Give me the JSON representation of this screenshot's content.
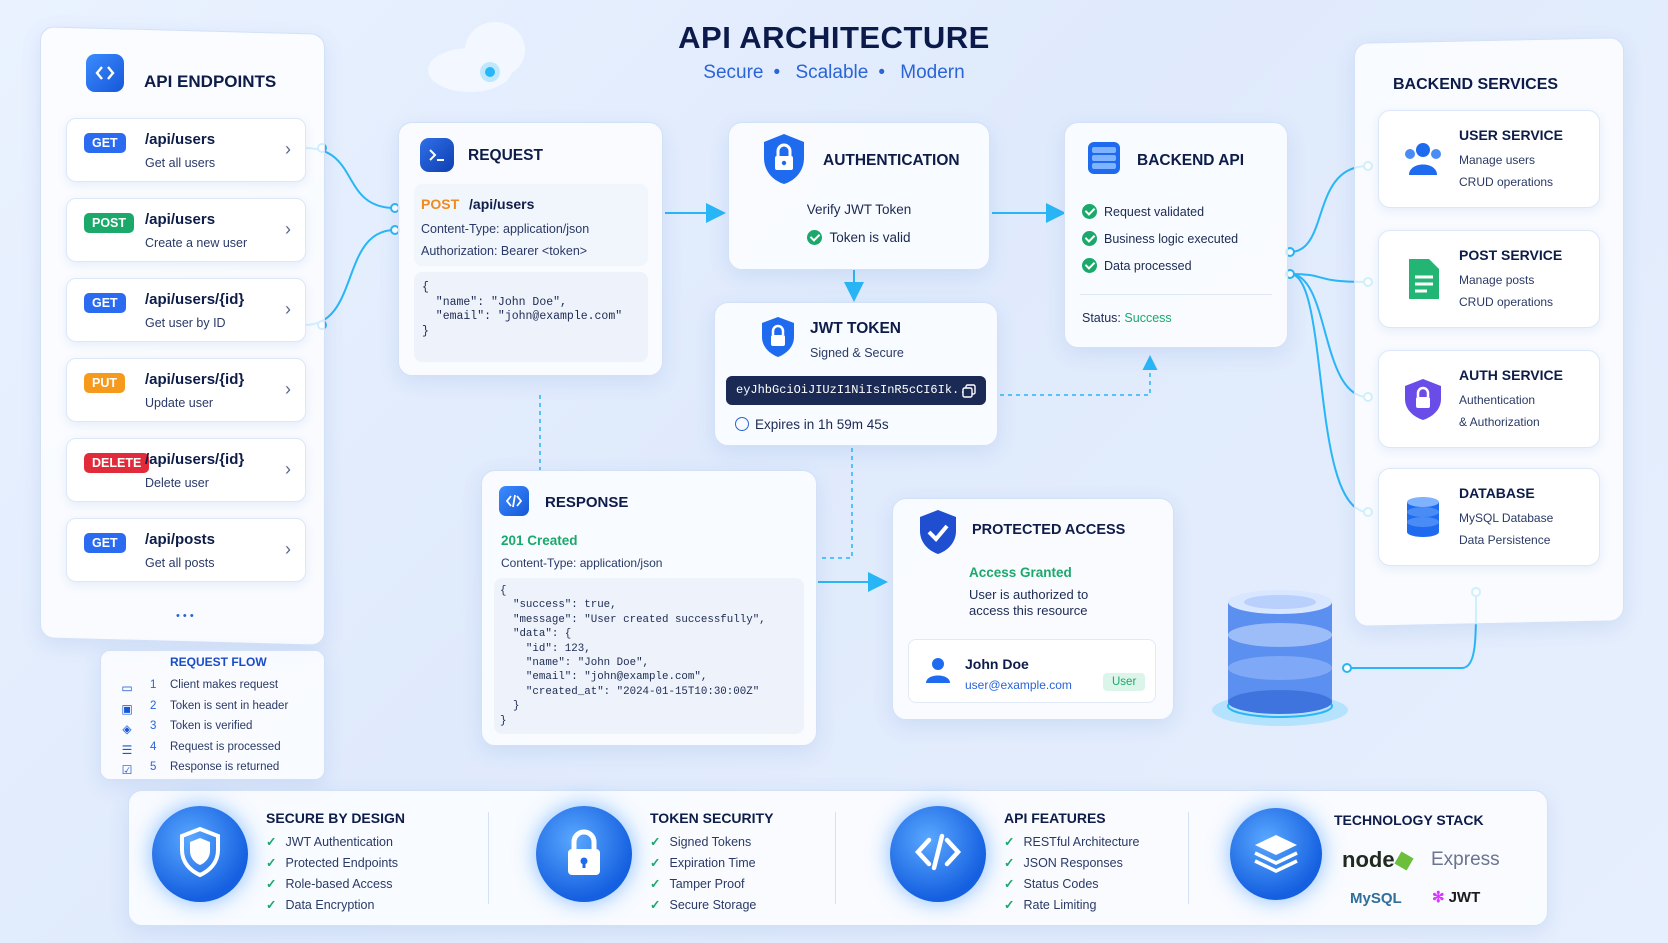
{
  "header": {
    "title": "API ARCHITECTURE",
    "tags": [
      "Secure",
      "Scalable",
      "Modern"
    ]
  },
  "endpoints": {
    "title": "API ENDPOINTS",
    "items": [
      {
        "method": "GET",
        "color": "#2a6bf2",
        "path": "/api/users",
        "desc": "Get all users"
      },
      {
        "method": "POST",
        "color": "#1aa96a",
        "path": "/api/users",
        "desc": "Create a new user"
      },
      {
        "method": "GET",
        "color": "#2a6bf2",
        "path": "/api/users/{id}",
        "desc": "Get user by ID"
      },
      {
        "method": "PUT",
        "color": "#f59a1c",
        "path": "/api/users/{id}",
        "desc": "Update user"
      },
      {
        "method": "DELETE",
        "color": "#e22b3a",
        "path": "/api/users/{id}",
        "desc": "Delete user"
      },
      {
        "method": "GET",
        "color": "#2a6bf2",
        "path": "/api/posts",
        "desc": "Get all posts"
      }
    ],
    "more": "• • •"
  },
  "request_flow": {
    "title": "REQUEST FLOW",
    "steps": [
      {
        "num": "1",
        "text": "Client makes request",
        "icon": "monitor-icon"
      },
      {
        "num": "2",
        "text": "Token is sent in header",
        "icon": "lock-icon"
      },
      {
        "num": "3",
        "text": "Token is verified",
        "icon": "shield-icon"
      },
      {
        "num": "4",
        "text": "Request is processed",
        "icon": "server-icon"
      },
      {
        "num": "5",
        "text": "Response is returned",
        "icon": "check-square-icon"
      }
    ]
  },
  "request": {
    "title": "REQUEST",
    "method": "POST",
    "path": "/api/users",
    "content_type_label": "Content-Type:",
    "content_type": "application/json",
    "auth_label": "Authorization:",
    "auth": "Bearer <token>",
    "body_lines": [
      "{",
      "  \"name\": \"John Doe\",",
      "  \"email\": \"john@example.com\"",
      "}"
    ]
  },
  "authentication": {
    "title": "AUTHENTICATION",
    "line1": "Verify JWT Token",
    "line2": "Token is valid"
  },
  "jwt": {
    "title": "JWT TOKEN",
    "subtitle": "Signed & Secure",
    "token": "eyJhbGciOiJIUzI1NiIsInR5cCI6Ik..",
    "expires": "Expires in 1h 59m 45s"
  },
  "backend_api": {
    "title": "BACKEND API",
    "checks": [
      "Request validated",
      "Business logic executed",
      "Data processed"
    ],
    "status_label": "Status:",
    "status": "Success"
  },
  "response": {
    "title": "RESPONSE",
    "code": "201 Created",
    "content_type_label": "Content-Type:",
    "content_type": "application/json",
    "body_lines": [
      "{",
      "  \"success\": true,",
      "  \"message\": \"User created successfully\",",
      "  \"data\": {",
      "    \"id\": 123,",
      "    \"name\": \"John Doe\",",
      "    \"email\": \"john@example.com\",",
      "    \"created_at\": \"2024-01-15T10:30:00Z\"",
      "  }",
      "}"
    ]
  },
  "protected": {
    "title": "PROTECTED ACCESS",
    "granted": "Access Granted",
    "desc_line1": "User is authorized to",
    "desc_line2": "access this resource",
    "user_name": "John Doe",
    "user_email": "user@example.com",
    "role": "User"
  },
  "backend_services": {
    "title": "BACKEND SERVICES",
    "items": [
      {
        "title": "USER SERVICE",
        "line1": "Manage users",
        "line2": "CRUD operations",
        "icon": "users-icon"
      },
      {
        "title": "POST SERVICE",
        "line1": "Manage posts",
        "line2": "CRUD operations",
        "icon": "document-icon"
      },
      {
        "title": "AUTH SERVICE",
        "line1": "Authentication",
        "line2": "& Authorization",
        "icon": "shield-lock-icon"
      },
      {
        "title": "DATABASE",
        "line1": "MySQL Database",
        "line2": "Data Persistence",
        "icon": "database-icon"
      }
    ]
  },
  "features": [
    {
      "title": "SECURE BY DESIGN",
      "icon": "shield-icon",
      "items": [
        "JWT Authentication",
        "Protected Endpoints",
        "Role-based Access",
        "Data Encryption"
      ]
    },
    {
      "title": "TOKEN SECURITY",
      "icon": "lock-icon",
      "items": [
        "Signed Tokens",
        "Expiration Time",
        "Tamper Proof",
        "Secure Storage"
      ]
    },
    {
      "title": "API FEATURES",
      "icon": "code-icon",
      "items": [
        "RESTful Architecture",
        "JSON Responses",
        "Status Codes",
        "Rate Limiting"
      ]
    }
  ],
  "tech_stack": {
    "title": "TECHNOLOGY STACK",
    "items": [
      "node",
      "Express",
      "MySQL",
      "JWT"
    ]
  },
  "colors": {
    "accent": "#2a64d8",
    "success": "#1aa96a",
    "connector": "#29b6f6"
  }
}
